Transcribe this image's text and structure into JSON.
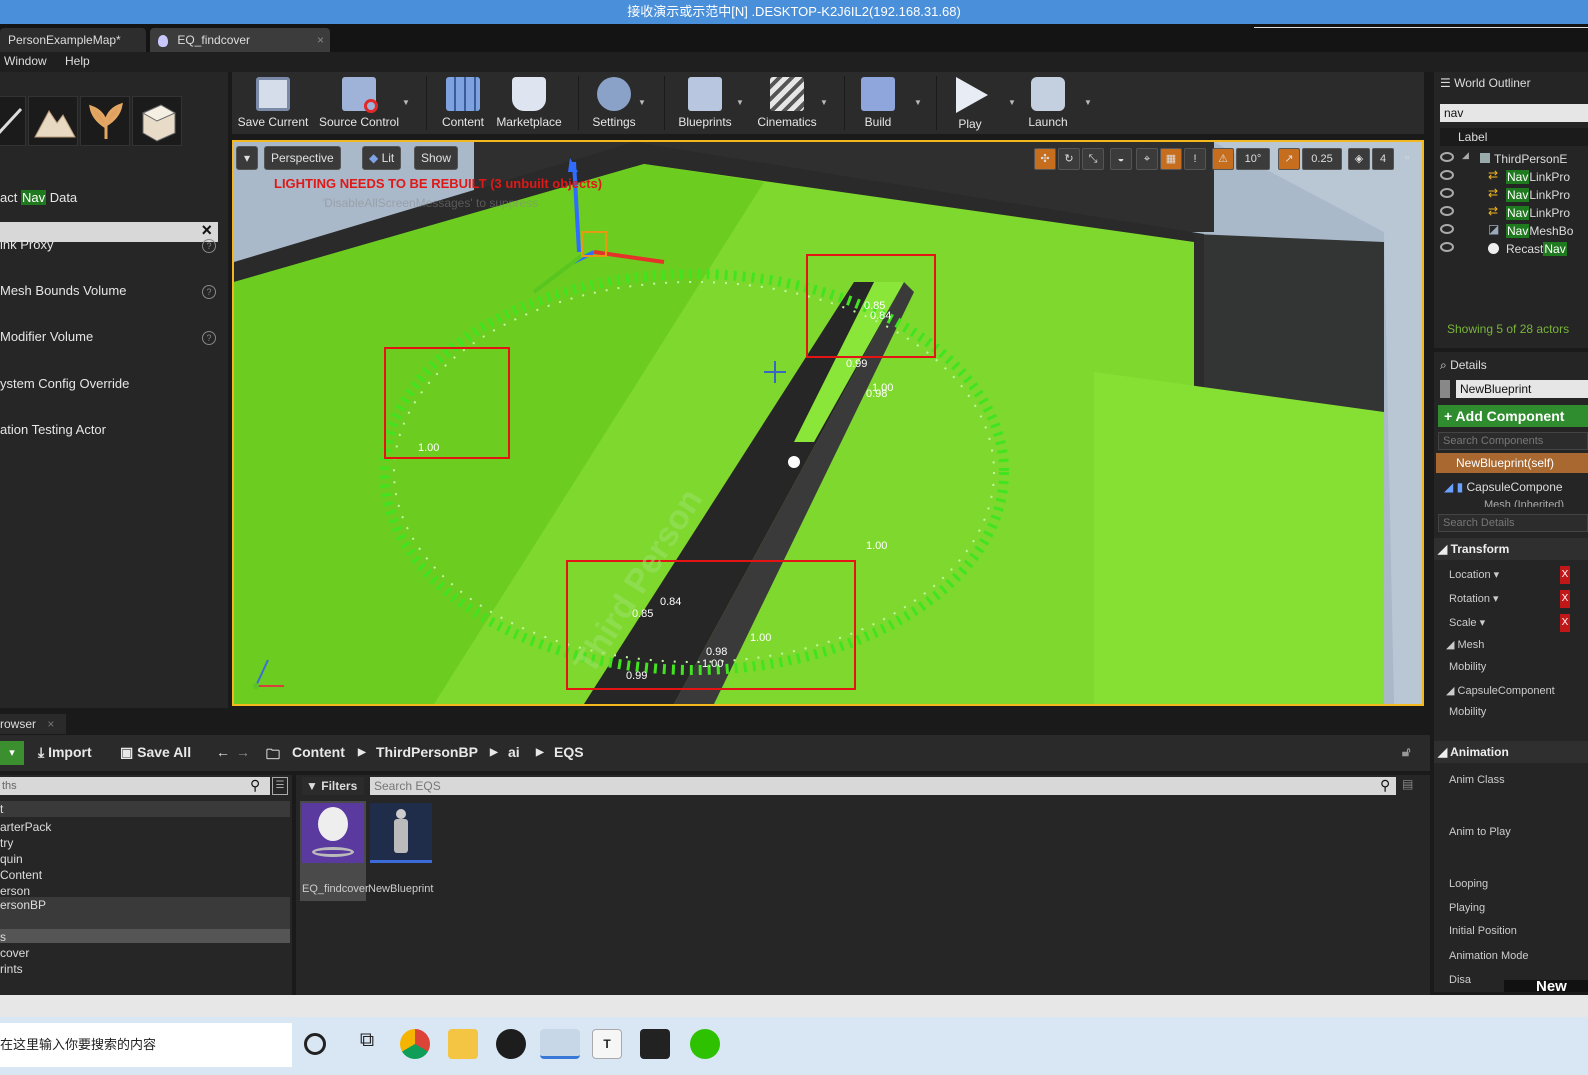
{
  "window": {
    "title": "接收演示或示范中[N] .DESKTOP-K2J6IL2(192.168.31.68)"
  },
  "tabs": [
    {
      "label": "PersonExampleMap*"
    },
    {
      "label": "EQ_findcover"
    }
  ],
  "menu": {
    "window": "Window",
    "help": "Help"
  },
  "placement": {
    "items": [
      {
        "label_prefix": "act ",
        "label_highlight": "Nav",
        "label_suffix": " Data"
      },
      {
        "label": "ink Proxy"
      },
      {
        "label": "Mesh Bounds Volume"
      },
      {
        "label": "Modifier Volume"
      },
      {
        "label": "ystem Config Override"
      },
      {
        "label": "ation Testing Actor"
      }
    ],
    "help_icon": "?"
  },
  "toolbar": {
    "items": [
      {
        "label": "Save Current",
        "icon": "save-icon"
      },
      {
        "label": "Source Control",
        "icon": "source-control-icon"
      },
      {
        "label": "Content",
        "icon": "content-icon"
      },
      {
        "label": "Marketplace",
        "icon": "marketplace-icon"
      },
      {
        "label": "Settings",
        "icon": "settings-icon"
      },
      {
        "label": "Blueprints",
        "icon": "blueprints-icon"
      },
      {
        "label": "Cinematics",
        "icon": "cinematics-icon"
      },
      {
        "label": "Build",
        "icon": "build-icon"
      },
      {
        "label": "Play",
        "icon": "play-icon"
      },
      {
        "label": "Launch",
        "icon": "launch-icon"
      }
    ]
  },
  "viewport": {
    "perspective": "Perspective",
    "lit": "Lit",
    "show": "Show",
    "lighting_warning": "LIGHTING NEEDS TO BE REBUILT (3 unbuilt objects)",
    "disable_hint": "'DisableAllScreenMessages' to suppress",
    "snap_rotation": "10°",
    "snap_scale": "0.25",
    "camera_speed": "4",
    "exclaim": "!",
    "text_labels": [
      {
        "text": "0.85"
      },
      {
        "text": "0.84"
      },
      {
        "text": "0.99"
      },
      {
        "text": "0.98"
      },
      {
        "text": "1.00"
      },
      {
        "text": "0.85"
      },
      {
        "text": "0.84"
      },
      {
        "text": "0.98"
      },
      {
        "text": "1.00"
      },
      {
        "text": "0.99"
      },
      {
        "text": "1.00"
      },
      {
        "text": "1.00"
      },
      {
        "text": "1.00"
      }
    ],
    "floor_text": "Third Person"
  },
  "outliner": {
    "title": "World Outliner",
    "search": "nav",
    "label_col": "Label",
    "rows": [
      {
        "prefix": "",
        "highlight": "",
        "suffix": "ThirdPersonE"
      },
      {
        "prefix": "",
        "highlight": "Nav",
        "suffix": "LinkPro"
      },
      {
        "prefix": "",
        "highlight": "Nav",
        "suffix": "LinkPro"
      },
      {
        "prefix": "",
        "highlight": "Nav",
        "suffix": "LinkPro"
      },
      {
        "prefix": "",
        "highlight": "Nav",
        "suffix": "MeshBo"
      },
      {
        "prefix": "Recast",
        "highlight": "Nav",
        "suffix": ""
      }
    ],
    "footer": "Showing 5 of 28 actors"
  },
  "details": {
    "title": "Details",
    "name": "NewBlueprint",
    "add_component": "+ Add Component",
    "search_components": "Search Components",
    "self_row": "NewBlueprint(self)",
    "capsule": "CapsuleCompone",
    "mesh_inherited": "Mesh (Inherited)",
    "search_details": "Search Details",
    "sections": {
      "transform": "Transform",
      "location": "Location ▾",
      "rotation": "Rotation ▾",
      "scale": "Scale ▾",
      "mesh": "Mesh",
      "mobility": "Mobility",
      "capsule_component": "CapsuleComponent",
      "mobility2": "Mobility",
      "animation": "Animation",
      "anim_class": "Anim Class",
      "anim_to_play": "Anim to Play",
      "looping": "Looping",
      "playing": "Playing",
      "initial_position": "Initial Position",
      "animation_mode": "Animation Mode",
      "disa": "Disa",
      "new": "New"
    }
  },
  "content_browser": {
    "tab": "rowser",
    "import": "Import",
    "save_all": "Save All",
    "breadcrumb": [
      "Content",
      "ThirdPersonBP",
      "ai",
      "EQS"
    ],
    "paths_search": "ths",
    "filters": "Filters",
    "search_placeholder": "Search EQS",
    "tree": [
      {
        "label": "t"
      },
      {
        "label": "arterPack"
      },
      {
        "label": "try"
      },
      {
        "label": "quin"
      },
      {
        "label": "Content"
      },
      {
        "label": "erson"
      },
      {
        "label": "ersonBP"
      },
      {
        "label": ""
      },
      {
        "label": "s"
      },
      {
        "label": "cover"
      },
      {
        "label": "rints"
      }
    ],
    "assets": [
      {
        "label": "EQ_findcover"
      },
      {
        "label": "NewBlueprint"
      }
    ]
  },
  "taskbar": {
    "search": "在这里输入你要搜索的内容",
    "apps": [
      "cortana-icon",
      "task-view-icon",
      "chrome-icon",
      "explorer-icon",
      "unreal-icon",
      "remote-icon",
      "typora-icon",
      "epic-icon",
      "wechat-icon"
    ]
  }
}
